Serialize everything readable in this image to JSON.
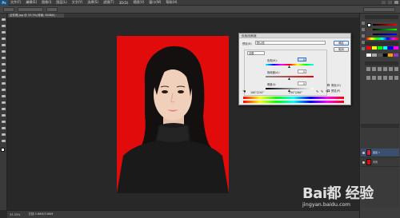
{
  "app": {
    "logo": "Ps",
    "menu": [
      "文件(F)",
      "编辑(E)",
      "图像(I)",
      "图层(L)",
      "文字(Y)",
      "选择(S)",
      "滤镜(T)",
      "3D(D)",
      "视图(V)",
      "窗口(W)",
      "帮助(H)"
    ],
    "document_tab": "证件照.jpg @ 33.3%(背景, RGB/8)"
  },
  "status": {
    "zoom": "33.33%",
    "doc_size": "文档:3.86M/3.86M"
  },
  "dialog": {
    "title": "色相/饱和度",
    "preset_label": "预设(E):",
    "preset_value": "默认值",
    "channel_value": "全图",
    "hue_label": "色相(H):",
    "hue_value": "0",
    "saturation_label": "饱和度(A):",
    "saturation_value": "0",
    "lightness_label": "明度(I):",
    "lightness_value": "0",
    "ok_label": "确定",
    "cancel_label": "取消",
    "colorize_label": "着色(O)",
    "preview_label": "预览(P)",
    "range_left": "180°/220°",
    "range_right": "250°/280°"
  },
  "layers": {
    "items": [
      {
        "name": "图层 1"
      },
      {
        "name": "背景"
      }
    ]
  },
  "watermark": {
    "logo": "Bai都 经验",
    "url": "jingyan.baidu.com"
  },
  "colors": {
    "photo_background": "#e10b0b",
    "dialog_bg": "#ececec",
    "accent": "#2d6fd3"
  }
}
